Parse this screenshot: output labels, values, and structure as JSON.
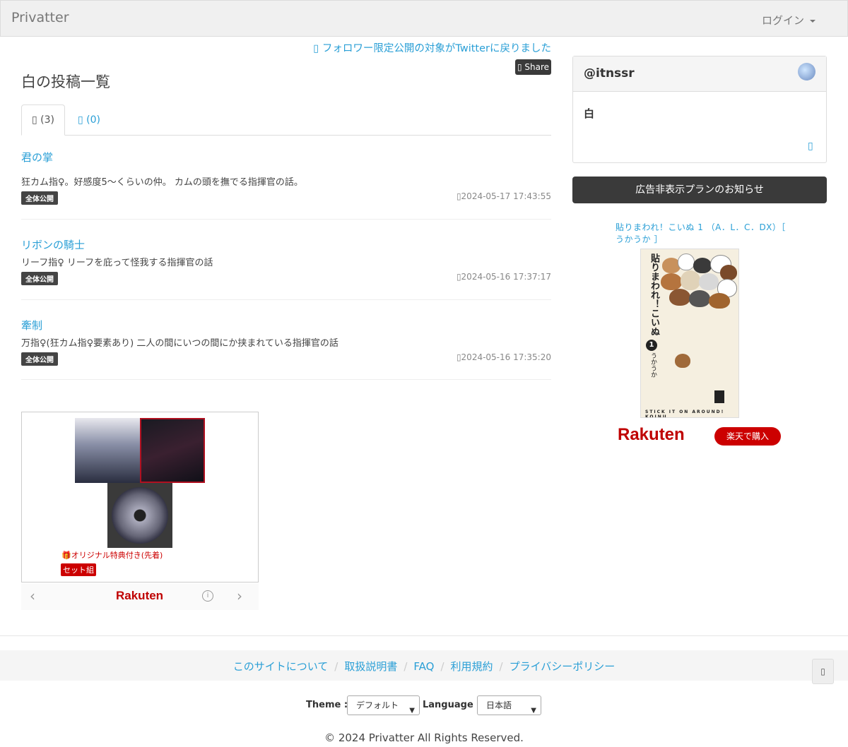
{
  "navbar": {
    "brand": "Privatter",
    "login": "ログイン"
  },
  "notice": "フォロワー限定公開の対象がTwitterに戻りました",
  "share_label": "Share",
  "page_title": "白の投稿一覧",
  "tabs": [
    {
      "label": "(3)",
      "active": true
    },
    {
      "label": "(0)",
      "active": false
    }
  ],
  "posts": [
    {
      "title": "君の掌",
      "desc": "狂カム指♀。好感度5〜くらいの仲。 カムの頭を撫でる指揮官の話。",
      "badge": "全体公開",
      "date": "2024-05-17 17:43:55"
    },
    {
      "title": "リボンの騎士",
      "desc": "リーフ指♀ リーフを庇って怪我する指揮官の話",
      "badge": "全体公開",
      "date": "2024-05-16 17:37:17"
    },
    {
      "title": "牽制",
      "desc": "万指♀(狂カム指♀要素あり) 二人の間にいつの間にか挟まれている指揮官の話",
      "badge": "全体公開",
      "date": "2024-05-16 17:35:20"
    }
  ],
  "ad_left": {
    "tagline": "オリジナル特典付き(先着)",
    "set_label": "セット組",
    "brand": "Rakuten"
  },
  "profile": {
    "handle": "@itnssr",
    "body": "白"
  },
  "plan_button": "広告非表示プランのお知らせ",
  "ad_right": {
    "title": "貼りまわれ！こいぬ 1 （A．L．C．DX）［ うかうか ］",
    "book_title": "貼りまわれ！こいぬ",
    "book_vol": "1",
    "book_author": "うかうか",
    "book_footer": "STICK IT ON AROUND! KOINU",
    "brand": "Rakuten",
    "buy_label": "楽天で購入"
  },
  "footer": {
    "links": [
      "このサイトについて",
      "取扱説明書",
      "FAQ",
      "利用規約",
      "プライバシーポリシー"
    ],
    "theme_label": "Theme :",
    "theme_value": "デフォルト",
    "language_label": "Language :",
    "language_value": "日本語",
    "copyright": "© 2024 Privatter All Rights Reserved."
  },
  "colors": {
    "link": "#2a9fd6",
    "dark_button": "#3a3a3a",
    "rakuten_red": "#bf0000"
  }
}
